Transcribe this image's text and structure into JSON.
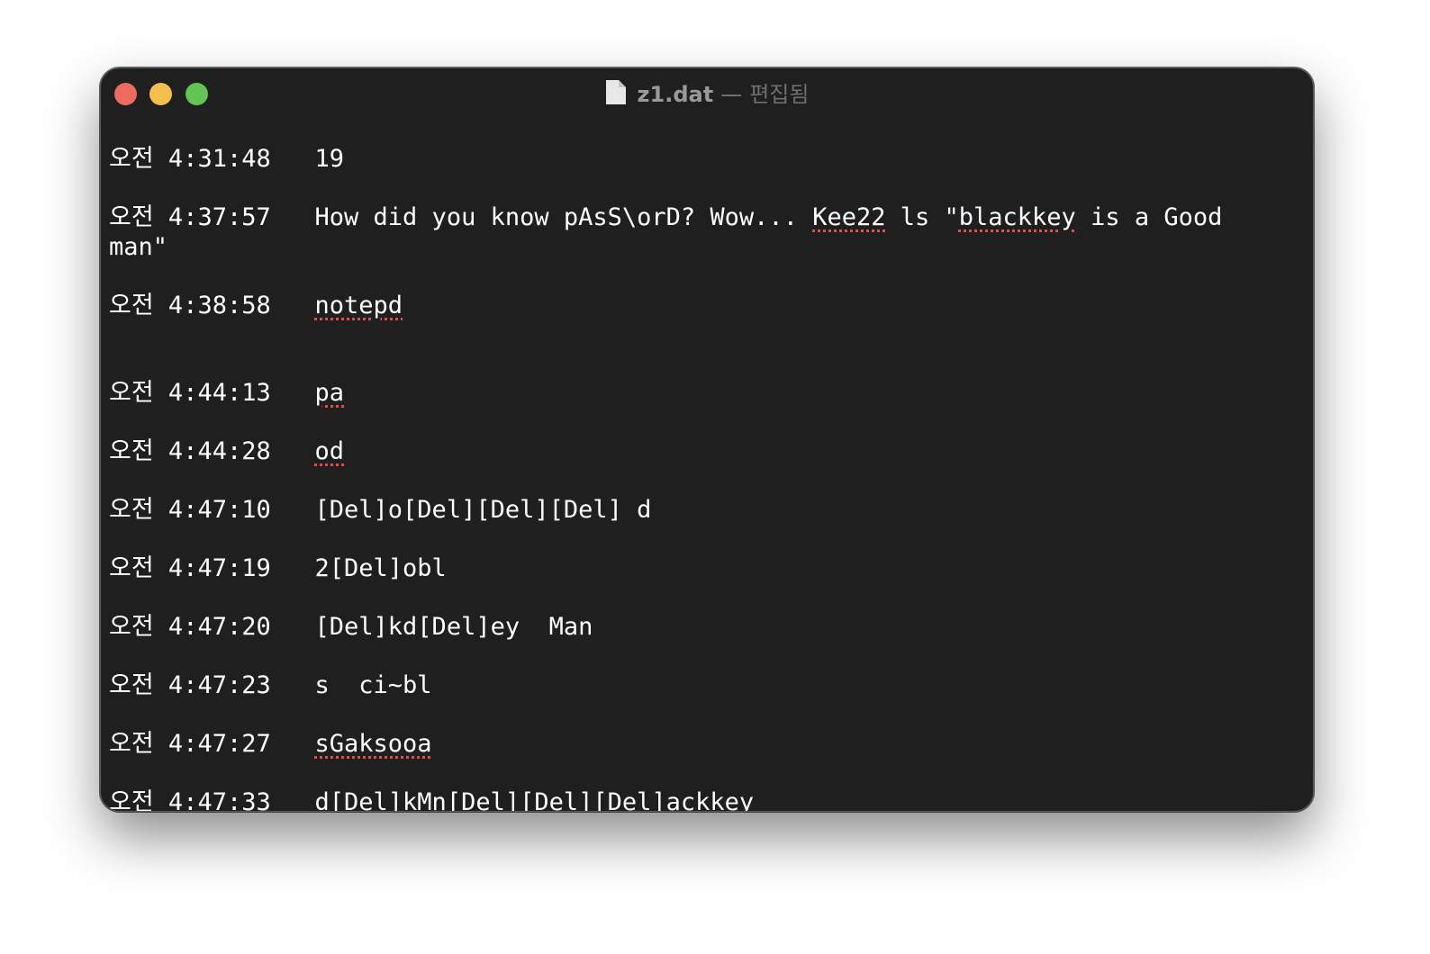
{
  "window": {
    "file_name": "z1.dat",
    "separator": "—",
    "status": "편집됨"
  },
  "entries": [
    {
      "time": "오전 4:31:48",
      "segments": [
        {
          "text": "19"
        }
      ]
    },
    {
      "time": "오전 4:37:57",
      "segments": [
        {
          "text": "How did you know pAsS\\orD? Wow... "
        },
        {
          "text": "Kee22",
          "misspelled": true
        },
        {
          "text": " ls \""
        },
        {
          "text": "blackkey",
          "misspelled": true
        },
        {
          "text": " is a Good man\""
        }
      ]
    },
    {
      "time": "오전 4:38:58",
      "segments": [
        {
          "text": "notepd",
          "misspelled": true
        }
      ]
    },
    {
      "time": "오전 4:44:13",
      "gap_before": true,
      "segments": [
        {
          "text": "pa",
          "misspelled": true
        }
      ]
    },
    {
      "time": "오전 4:44:28",
      "segments": [
        {
          "text": "od",
          "misspelled": true
        }
      ]
    },
    {
      "time": "오전 4:47:10",
      "segments": [
        {
          "text": "[Del]o[Del][Del][Del] d"
        }
      ]
    },
    {
      "time": "오전 4:47:19",
      "segments": [
        {
          "text": "2[Del]obl"
        }
      ]
    },
    {
      "time": "오전 4:47:20",
      "segments": [
        {
          "text": "[Del]kd[Del]ey  Man"
        }
      ]
    },
    {
      "time": "오전 4:47:23",
      "segments": [
        {
          "text": "s  ci~bl"
        }
      ]
    },
    {
      "time": "오전 4:47:27",
      "segments": [
        {
          "text": "sGaksooa",
          "misspelled": true
        }
      ]
    },
    {
      "time": "오전 4:47:33",
      "segments": [
        {
          "text": "d[Del]kMn[Del][Del][Del]ackkey"
        }
      ]
    }
  ],
  "icons": {
    "close": "close-button",
    "minimize": "minimize-button",
    "zoom": "zoom-button",
    "document": "document-icon"
  },
  "colors": {
    "close": "#ec6a5e",
    "minimize": "#f4bf4f",
    "zoom": "#61c554",
    "background": "#1f1f1f",
    "text": "#ffffff",
    "spellcheck": "#e04f4f"
  }
}
